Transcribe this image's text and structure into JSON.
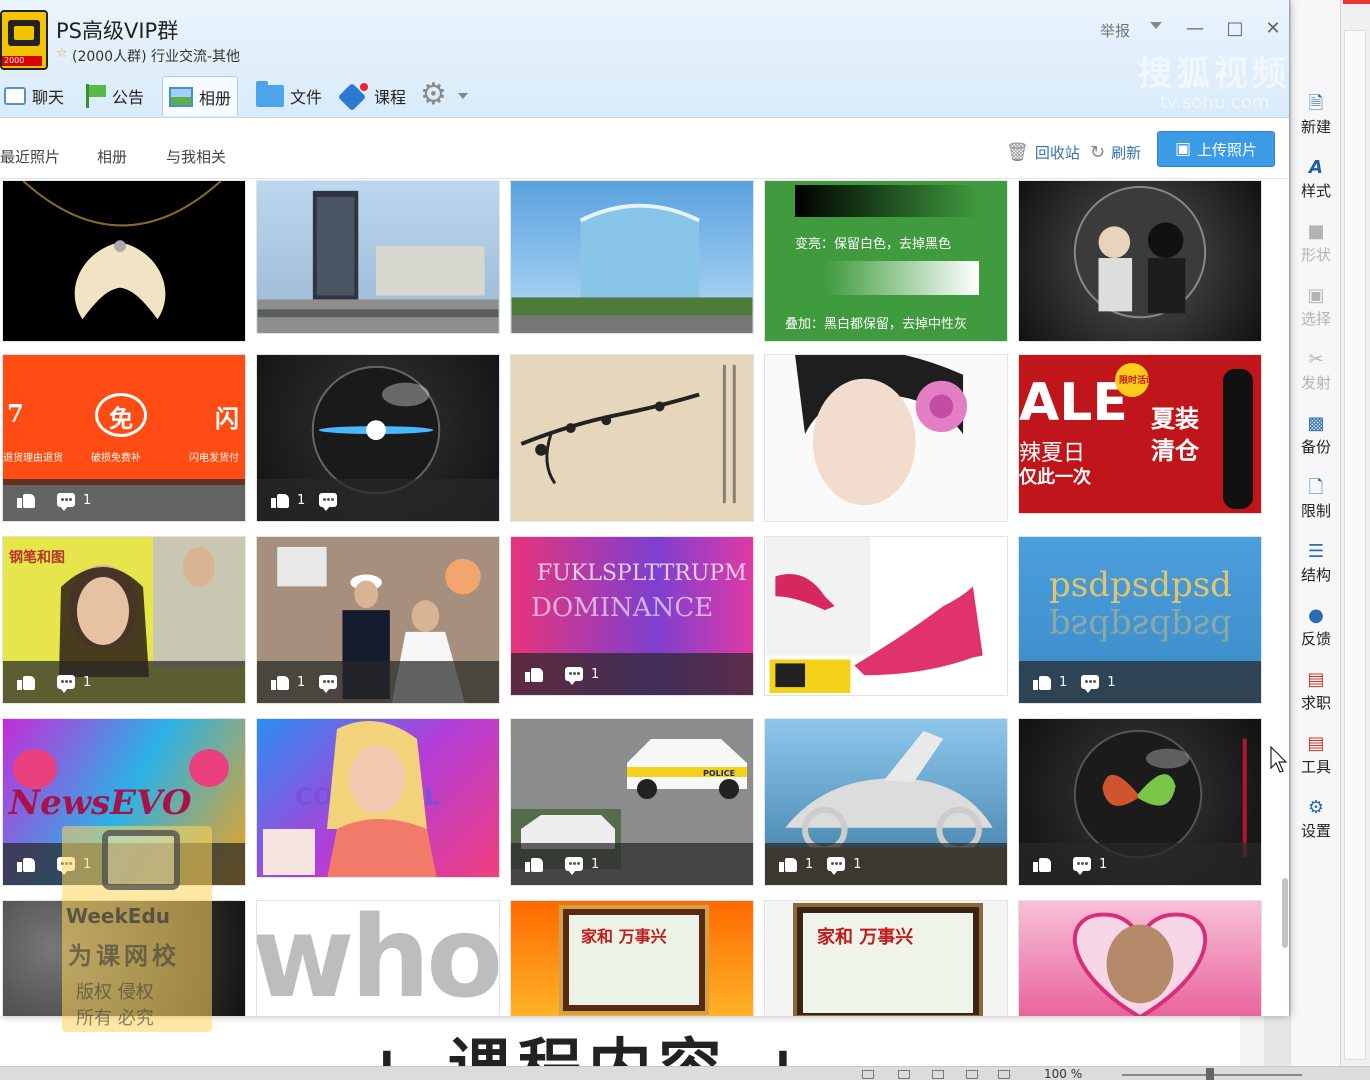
{
  "window": {
    "title": "PS高级VIP群",
    "meta": "(2000人群) 行业交流-其他",
    "avatar_badge": "2000",
    "report_label": "举报",
    "watermark": "搜狐视频",
    "watermark_url": "tv.sohu.com"
  },
  "tabs": [
    {
      "label": "聊天",
      "icon": "chat-icon"
    },
    {
      "label": "公告",
      "icon": "flag-icon"
    },
    {
      "label": "相册",
      "icon": "photo-icon",
      "active": true
    },
    {
      "label": "文件",
      "icon": "folder-icon"
    },
    {
      "label": "课程",
      "icon": "course-icon"
    }
  ],
  "album": {
    "subtabs": [
      "最近照片",
      "相册",
      "与我相关"
    ],
    "recycle_label": "回收站",
    "refresh_label": "刷新",
    "upload_label": "上传照片"
  },
  "photos": [
    {
      "texts": [],
      "likes": "",
      "comments": ""
    },
    {
      "texts": [],
      "likes": "",
      "comments": ""
    },
    {
      "texts": [],
      "likes": "",
      "comments": ""
    },
    {
      "texts": [
        "变亮：保留白色，去掉黑色",
        "叠加：黑白都保留，去掉中性灰"
      ],
      "likes": "",
      "comments": ""
    },
    {
      "texts": [],
      "likes": "",
      "comments": ""
    },
    {
      "texts": [
        "免",
        "闪",
        "7",
        "退货理由退货",
        "破损免费补",
        "闪电发货付"
      ],
      "likes": "",
      "comments": "1",
      "overlay": true
    },
    {
      "texts": [],
      "likes": "1",
      "comments": "",
      "overlay": true
    },
    {
      "texts": [],
      "likes": "",
      "comments": ""
    },
    {
      "texts": [],
      "likes": "",
      "comments": ""
    },
    {
      "texts": [
        "ALE",
        "夏装",
        "清仓",
        "辣夏日",
        "仅此一次",
        "限时活动"
      ],
      "likes": "",
      "comments": ""
    },
    {
      "texts": [
        "钢笔和图"
      ],
      "likes": "",
      "comments": "1",
      "overlay": true
    },
    {
      "texts": [],
      "likes": "1",
      "comments": "",
      "overlay": true
    },
    {
      "texts": [
        "FUKLSPLTTRUPM",
        "DOMINANCE"
      ],
      "likes": "",
      "comments": "1",
      "overlay": true
    },
    {
      "texts": [],
      "likes": "",
      "comments": ""
    },
    {
      "texts": [
        "psdpsdpsd"
      ],
      "likes": "1",
      "comments": "1",
      "overlay": true
    },
    {
      "texts": [
        "NewsEVO"
      ],
      "likes": "",
      "comments": "1",
      "overlay": true
    },
    {
      "texts": [
        "COOL GIRL"
      ],
      "likes": "",
      "comments": ""
    },
    {
      "texts": [
        "POLICE"
      ],
      "likes": "",
      "comments": "1",
      "overlay": true
    },
    {
      "texts": [],
      "likes": "1",
      "comments": "1",
      "overlay": true
    },
    {
      "texts": [],
      "likes": "",
      "comments": "1",
      "overlay": true
    },
    {
      "texts": [],
      "likes": "",
      "comments": ""
    },
    {
      "texts": [
        "who"
      ],
      "likes": "",
      "comments": ""
    },
    {
      "texts": [
        "家和 万事兴"
      ],
      "likes": "",
      "comments": ""
    },
    {
      "texts": [
        "家和 万事兴"
      ],
      "likes": "",
      "comments": ""
    },
    {
      "texts": [],
      "likes": "",
      "comments": ""
    }
  ],
  "ribbon": [
    {
      "label": "新建",
      "icon": "new-doc-icon",
      "enabled": true
    },
    {
      "label": "样式",
      "icon": "style-icon",
      "enabled": true
    },
    {
      "label": "形状",
      "icon": "shape-icon",
      "enabled": false
    },
    {
      "label": "选择",
      "icon": "select-icon",
      "enabled": false
    },
    {
      "label": "发射",
      "icon": "link-icon",
      "enabled": false
    },
    {
      "label": "备份",
      "icon": "backup-icon",
      "enabled": true
    },
    {
      "label": "限制",
      "icon": "restrict-icon",
      "enabled": true
    },
    {
      "label": "结构",
      "icon": "structure-icon",
      "enabled": true
    },
    {
      "label": "反馈",
      "icon": "feedback-icon",
      "enabled": true
    },
    {
      "label": "求职",
      "icon": "job-icon",
      "enabled": true
    },
    {
      "label": "工具",
      "icon": "toolbox-icon",
      "enabled": true
    },
    {
      "label": "设置",
      "icon": "settings-icon",
      "enabled": true
    }
  ],
  "document": {
    "heading": "+ 课程内容 +",
    "zoom": "100 %"
  },
  "watermark_weekedu": {
    "brand": "WeekEdu",
    "name": "为课网校",
    "copyright_line1": "版权  侵权",
    "copyright_line2": "所有  必究"
  }
}
